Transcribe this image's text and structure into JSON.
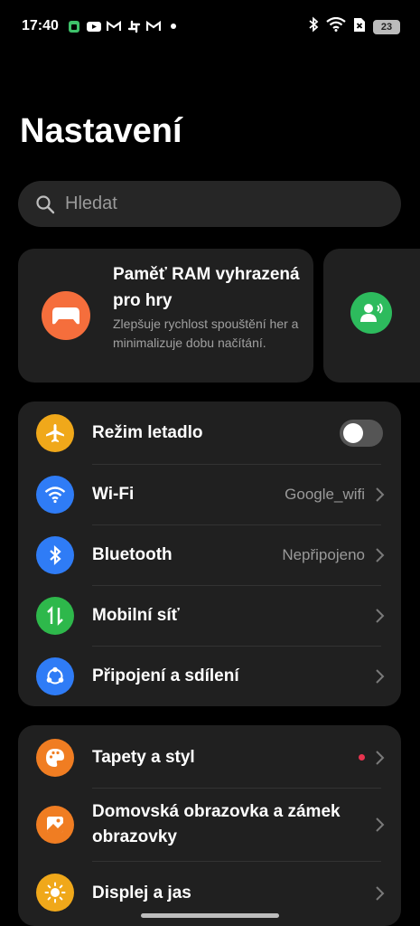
{
  "status_bar": {
    "time": "17:40",
    "app_icons": [
      "whatsapp-icon",
      "youtube-icon",
      "gmail-icon",
      "slack-icon",
      "gmail-icon",
      "dot-icon"
    ],
    "system_icons": [
      "bluetooth-icon",
      "wifi-icon",
      "no-sim-icon"
    ],
    "battery": "23"
  },
  "page": {
    "title": "Nastavení"
  },
  "search": {
    "placeholder": "Hledat"
  },
  "promo_cards": [
    {
      "icon": "gamepad-icon",
      "icon_color": "#f56e3c",
      "title": "Paměť RAM vyhrazená pro hry",
      "description": "Zlepšuje rychlost spouštění her a minimalizuje dobu načítání."
    },
    {
      "icon": "person-voice-icon",
      "icon_color": "#2dbb5d",
      "title": "",
      "description": ""
    }
  ],
  "group1": [
    {
      "label": "Režim letadlo",
      "icon": "airplane-icon",
      "icon_color": "#f0a81a",
      "toggle": "off"
    },
    {
      "label": "Wi-Fi",
      "icon": "wifi-icon",
      "icon_color": "#2f7cf6",
      "value": "Google_wifi"
    },
    {
      "label": "Bluetooth",
      "icon": "bluetooth-icon",
      "icon_color": "#2f7cf6",
      "value": "Nepřipojeno"
    },
    {
      "label": "Mobilní síť",
      "icon": "mobile-data-icon",
      "icon_color": "#2eb84b"
    },
    {
      "label": "Připojení a sdílení",
      "icon": "share-connection-icon",
      "icon_color": "#2f7cf6"
    }
  ],
  "group2": [
    {
      "label": "Tapety a styl",
      "icon": "palette-icon",
      "icon_color": "#f07d22",
      "badge": "red-dot"
    },
    {
      "label": "Domovská obrazovka a zámek obrazovky",
      "icon": "wallpaper-icon",
      "icon_color": "#f07d22"
    },
    {
      "label": "Displej a jas",
      "icon": "sun-icon",
      "icon_color": "#f0a81a"
    }
  ]
}
